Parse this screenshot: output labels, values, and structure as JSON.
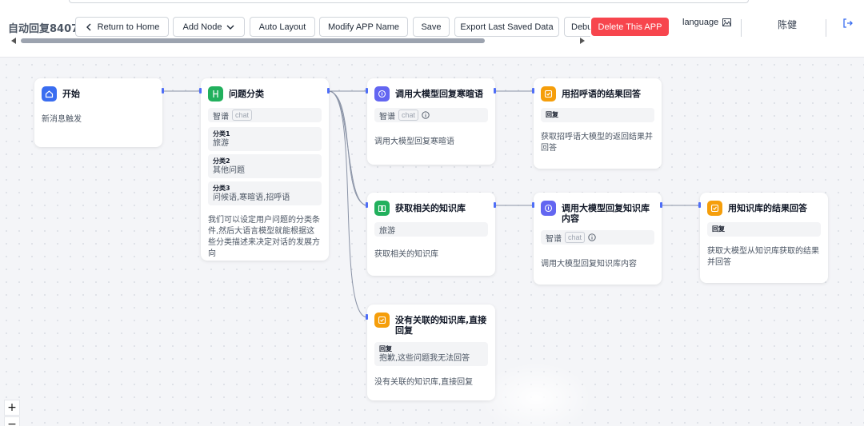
{
  "app": {
    "title": "自动回复8407"
  },
  "toolbar": {
    "return_home": "Return to Home",
    "add_node": "Add Node",
    "auto_layout": "Auto Layout",
    "modify_name": "Modify APP Name",
    "save": "Save",
    "export": "Export Last Saved Data",
    "debug": "Debug",
    "delete_app": "Delete This APP"
  },
  "header": {
    "language": "language",
    "user": "陈健"
  },
  "colors": {
    "delete": "#f7454d",
    "edge": "#8a93a6",
    "handle": "#4f6ef7"
  },
  "nodes": {
    "start": {
      "title": "开始",
      "desc": "新消息触发",
      "icon": "home-icon",
      "color": "#3a6df0"
    },
    "classify": {
      "title": "问题分类",
      "model": "智谱",
      "model_tag": "chat",
      "icon": "branch-icon",
      "color": "#22b05d",
      "categories": [
        {
          "label": "分类1",
          "value": "旅游"
        },
        {
          "label": "分类2",
          "value": "其他问题"
        },
        {
          "label": "分类3",
          "value": "问候语,寒暄语,招呼语"
        }
      ],
      "desc": "我们可以设定用户问题的分类条件,然后大语言模型就能根据这些分类描述来决定对话的发展方向"
    },
    "llm_greet": {
      "title": "调用大模型回复寒暄语",
      "model": "智谱",
      "model_tag": "chat",
      "desc": "调用大模型回复寒暄语",
      "icon": "ai-icon",
      "color": "#6366f1"
    },
    "reply_greet": {
      "title": "用招呼语的结果回答",
      "reply_label": "回复",
      "desc": "获取招呼语大模型的返回结果并回答",
      "icon": "reply-icon",
      "color": "#f59e0b"
    },
    "kb_get": {
      "title": "获取相关的知识库",
      "kb": "旅游",
      "desc": "获取相关的知识库",
      "icon": "book-icon",
      "color": "#22b05d"
    },
    "llm_kb": {
      "title": "调用大模型回复知识库内容",
      "model": "智谱",
      "model_tag": "chat",
      "desc": "调用大模型回复知识库内容",
      "icon": "ai-icon",
      "color": "#6366f1"
    },
    "reply_kb": {
      "title": "用知识库的结果回答",
      "reply_label": "回复",
      "desc": "获取大模型从知识库获取的结果并回答",
      "icon": "reply-icon",
      "color": "#f59e0b"
    },
    "no_kb": {
      "title": "没有关联的知识库,直接回复",
      "reply_label": "回复",
      "reply_text": "抱歉,这些问题我无法回答",
      "desc": "没有关联的知识库,直接回复",
      "icon": "reply-icon",
      "color": "#f59e0b"
    }
  },
  "zoom": {
    "in": "+",
    "out": "−"
  }
}
